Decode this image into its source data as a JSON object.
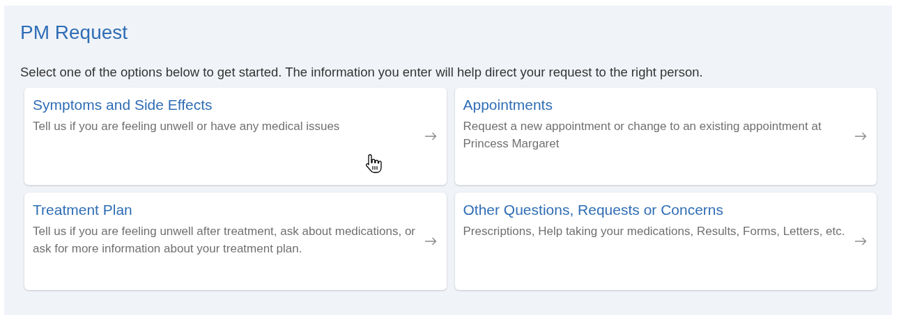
{
  "title": "PM Request",
  "intro": "Select one of the options below to get started. The information you enter will help direct your request to the right person.",
  "options": [
    {
      "title": "Symptoms and Side Effects",
      "description": "Tell us if you are feeling unwell or have any medical issues",
      "hovered": true
    },
    {
      "title": "Appointments",
      "description": "Request a new appointment or change to an existing appointment at Princess Margaret",
      "hovered": false
    },
    {
      "title": "Treatment Plan",
      "description": "Tell us if you are feeling unwell after treatment, ask about medications, or ask for more information about your treatment plan.",
      "hovered": false
    },
    {
      "title": "Other Questions, Requests or Concerns",
      "description": "Prescriptions, Help taking your medications, Results, Forms, Letters, etc.",
      "hovered": false
    }
  ]
}
